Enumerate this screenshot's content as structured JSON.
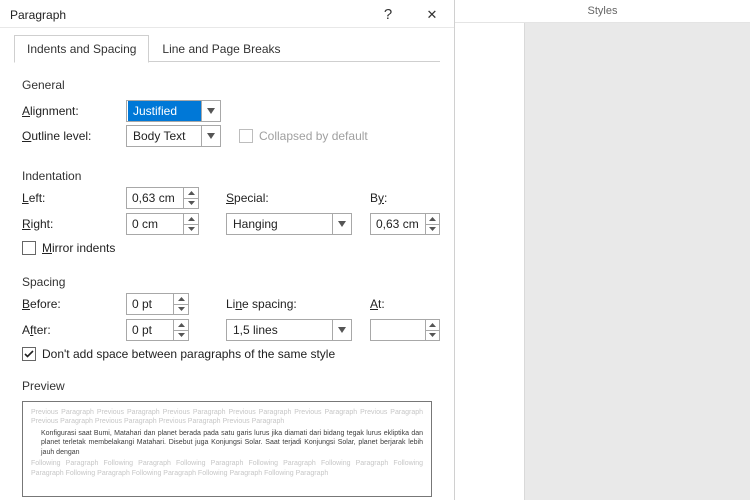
{
  "title": "Paragraph",
  "help_tooltip": "?",
  "close_tooltip": "✕",
  "tabs": {
    "indents": "Indents and Spacing",
    "breaks": "Line and Page Breaks"
  },
  "sections": {
    "general": "General",
    "indentation": "Indentation",
    "spacing": "Spacing",
    "preview": "Preview"
  },
  "general": {
    "alignment_label": "Alignment:",
    "alignment_value": "Justified",
    "outline_label": "Outline level:",
    "outline_value": "Body Text",
    "collapsed_label": "Collapsed by default"
  },
  "indent": {
    "left_label": "Left:",
    "left_value": "0,63 cm",
    "right_label": "Right:",
    "right_value": "0 cm",
    "special_label": "Special:",
    "special_value": "Hanging",
    "by_label": "By:",
    "by_value": "0,63 cm",
    "mirror_label": "Mirror indents"
  },
  "spacing": {
    "before_label": "Before:",
    "before_value": "0 pt",
    "after_label": "After:",
    "after_value": "0 pt",
    "line_spacing_label": "Line spacing:",
    "line_spacing_value": "1,5 lines",
    "at_label": "At:",
    "at_value": "",
    "no_space_label": "Don't add space between paragraphs of the same style"
  },
  "preview": {
    "ghost_prev": "Previous Paragraph Previous Paragraph Previous Paragraph Previous Paragraph Previous Paragraph Previous Paragraph Previous Paragraph Previous Paragraph Previous Paragraph Previous Paragraph",
    "body": "Konfigurasi saat Bumi, Matahari dan planet berada pada satu garis lurus jika diamati dari bidang tegak lurus ekliptika dan planet terletak membelakangi Matahari. Disebut juga Konjungsi Solar. Saat terjadi Konjungsi Solar, planet berjarak lebih jauh dengan",
    "ghost_next": "Following Paragraph Following Paragraph Following Paragraph Following Paragraph Following Paragraph Following Paragraph Following Paragraph Following Paragraph Following Paragraph Following Paragraph"
  },
  "sidebar": {
    "panel_label": "Styles"
  }
}
